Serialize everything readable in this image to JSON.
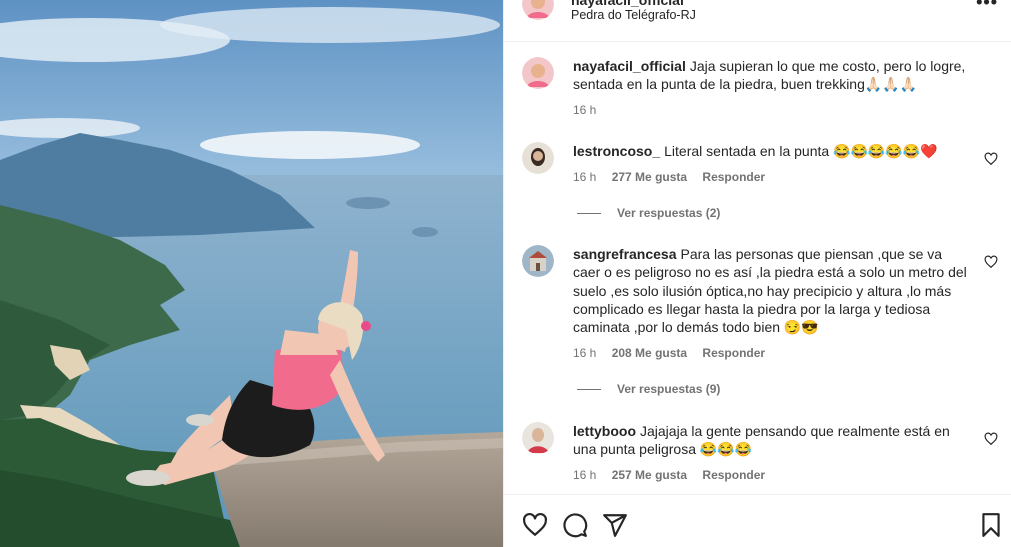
{
  "post": {
    "username": "nayafacil_official",
    "location": "Pedra do Telégrafo-RJ",
    "more_icon": "more-horizontal-icon"
  },
  "caption": {
    "username": "nayafacil_official",
    "text": "Jaja supieran lo que me costo, pero lo logre, sentada en la punta de la piedra, buen trekking🙏🏻🙏🏻🙏🏻",
    "time": "16 h"
  },
  "comments": [
    {
      "username": "lestroncoso_",
      "text": "Literal sentada en la punta 😂😂😂😂😂❤️",
      "time": "16 h",
      "likes": "277 Me gusta",
      "reply": "Responder",
      "view_replies": "Ver respuestas (2)"
    },
    {
      "username": "sangrefrancesa",
      "text": "Para las personas que piensan ,que se va caer o es peligroso no es así ,la piedra está a solo un metro del suelo ,es solo ilusión óptica,no hay precipicio y altura ,lo más complicado es llegar hasta la piedra por la larga y tediosa caminata ,por lo demás todo bien 😏😎",
      "time": "16 h",
      "likes": "208 Me gusta",
      "reply": "Responder",
      "view_replies": "Ver respuestas (9)"
    },
    {
      "username": "lettybooo",
      "text": "Jajajaja la gente pensando que realmente está en una punta peligrosa 😂😂😂",
      "time": "16 h",
      "likes": "257 Me gusta",
      "reply": "Responder"
    }
  ],
  "colors": {
    "text": "#262626",
    "secondary": "#737373",
    "divider": "#efefef",
    "heart": "#e0245e"
  }
}
